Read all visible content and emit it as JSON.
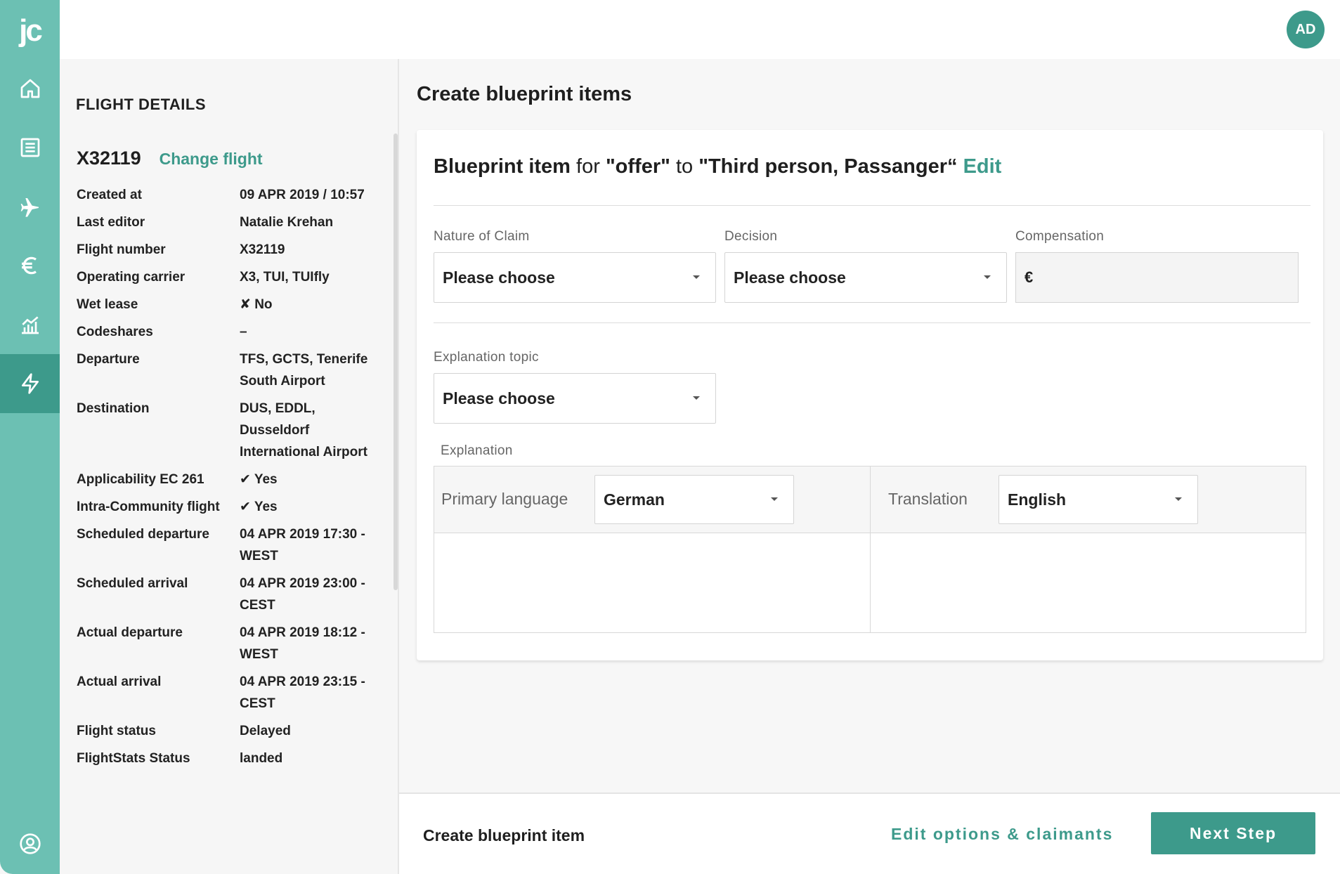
{
  "sidebar": {
    "logo": "jc",
    "items": [
      {
        "name": "home-icon"
      },
      {
        "name": "list-icon"
      },
      {
        "name": "airplane-icon"
      },
      {
        "name": "euro-icon"
      },
      {
        "name": "chart-icon"
      },
      {
        "name": "lightning-icon",
        "active": true
      }
    ],
    "bottom_icon": "user-circle-icon"
  },
  "topbar": {
    "avatar_initials": "AD"
  },
  "flight_details": {
    "title": "FLIGHT DETAILS",
    "flight_code": "X32119",
    "change_link": "Change flight",
    "rows": [
      {
        "label": "Created at",
        "value": "09 APR 2019 / 10:57"
      },
      {
        "label": "Last editor",
        "value": "Natalie Krehan"
      },
      {
        "label": "Flight number",
        "value": "X32119"
      },
      {
        "label": "Operating carrier",
        "value": "X3, TUI, TUIfly"
      },
      {
        "label": "Wet lease",
        "value": "✘ No"
      },
      {
        "label": "Codeshares",
        "value": "–"
      },
      {
        "label": "Departure",
        "value": "TFS, GCTS, Tenerife South Airport"
      },
      {
        "label": "Destination",
        "value": "DUS, EDDL, Dusseldorf International Airport"
      },
      {
        "label": "Applicability EC 261",
        "value": "✔ Yes"
      },
      {
        "label": "Intra-Community flight",
        "value": "✔ Yes"
      },
      {
        "label": "Scheduled departure",
        "value": "04 APR 2019 17:30 - WEST"
      },
      {
        "label": "Scheduled arrival",
        "value": "04 APR 2019 23:00 - CEST"
      },
      {
        "label": "Actual departure",
        "value": "04 APR 2019 18:12 - WEST"
      },
      {
        "label": "Actual arrival",
        "value": "04 APR 2019 23:15 - CEST"
      },
      {
        "label": "Flight status",
        "value": "Delayed"
      },
      {
        "label": "FlightStats Status",
        "value": "landed"
      }
    ]
  },
  "main": {
    "title": "Create blueprint items",
    "card": {
      "heading_prefix": "Blueprint item",
      "heading_for": " for ",
      "heading_offer": "\"offer\"",
      "heading_to": " to ",
      "heading_target": "\"Third person, Passanger“",
      "edit_link": "Edit",
      "nature_label": "Nature of Claim",
      "nature_value": "Please choose",
      "decision_label": "Decision",
      "decision_value": "Please choose",
      "compensation_label": "Compensation",
      "compensation_currency": "€",
      "topic_label": "Explanation topic",
      "topic_value": "Please choose",
      "explanation_label": "Explanation",
      "primary_language_label": "Primary language",
      "primary_language_value": "German",
      "translation_label": "Translation",
      "translation_value": "English"
    }
  },
  "bottom_bar": {
    "title": "Create blueprint item",
    "secondary_link": "Edit options & claimants",
    "primary_button": "Next Step"
  },
  "colors": {
    "brand": "#3d9a8b",
    "sidebar": "#6cc0b3"
  }
}
